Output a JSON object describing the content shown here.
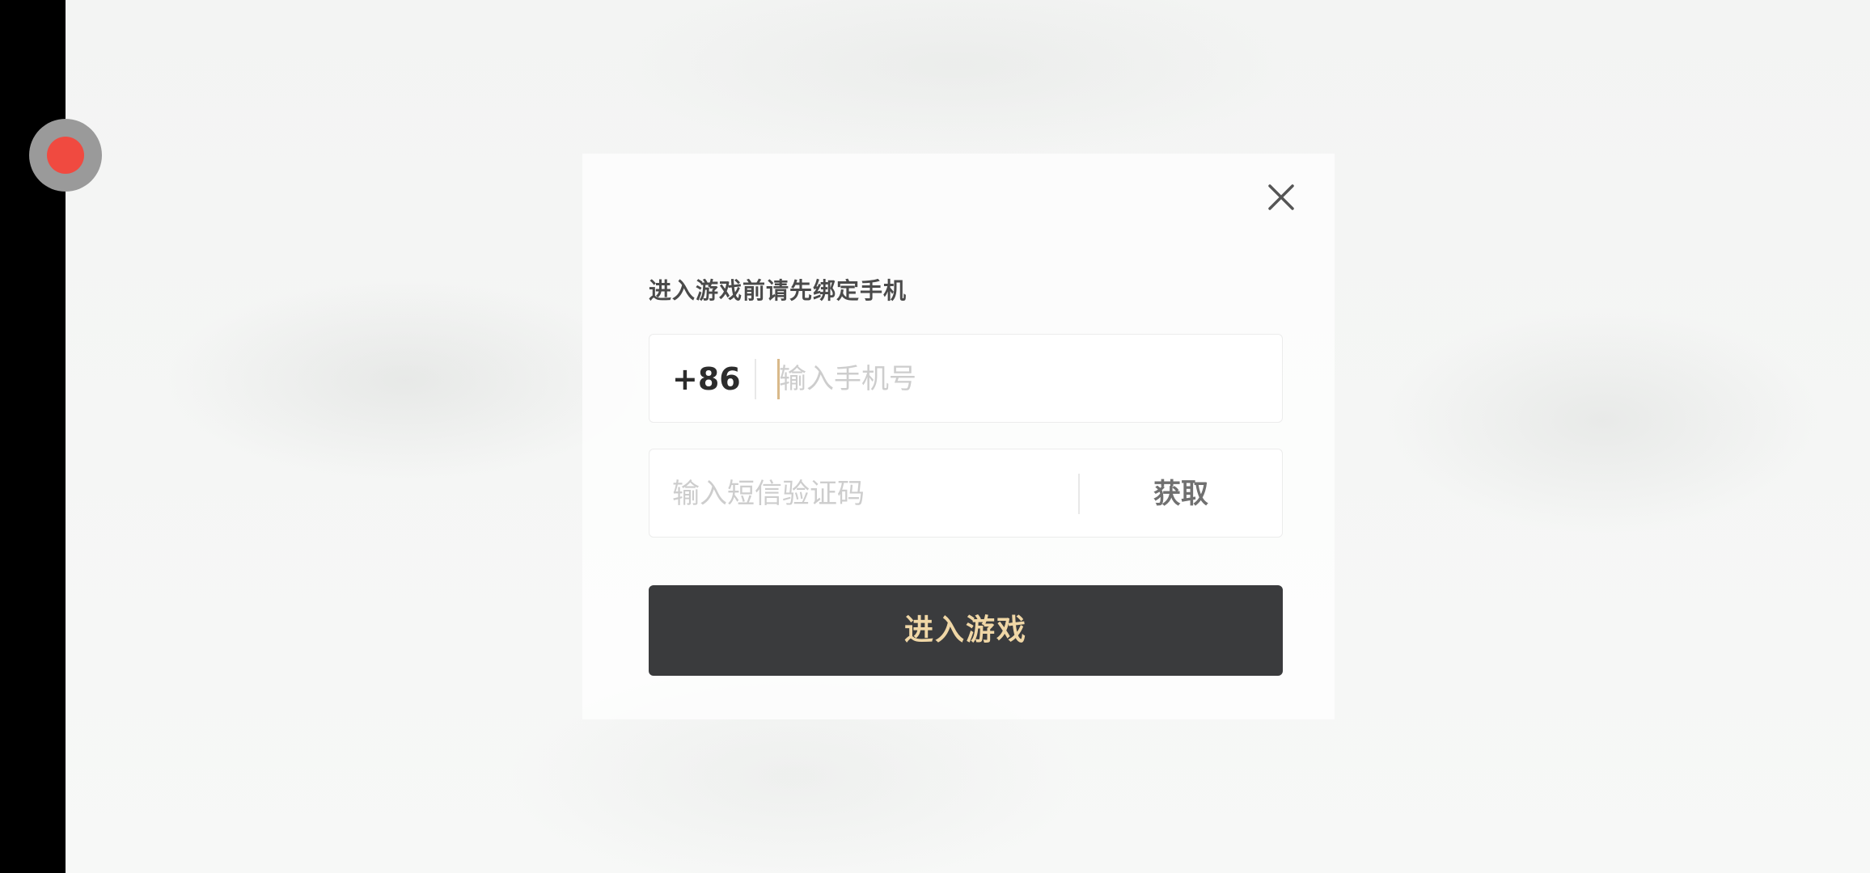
{
  "dialog": {
    "title": "进入游戏前请先绑定手机",
    "close_icon": "close-icon",
    "phone": {
      "country_code": "+86",
      "value": "",
      "placeholder": "输入手机号"
    },
    "sms": {
      "value": "",
      "placeholder": "输入短信验证码",
      "get_code_label": "获取"
    },
    "enter_button_label": "进入游戏"
  },
  "colors": {
    "button_bg": "#3a3b3d",
    "button_text": "#f0d7a6",
    "record_dot": "#f04a40",
    "caret": "#d9b98a"
  }
}
